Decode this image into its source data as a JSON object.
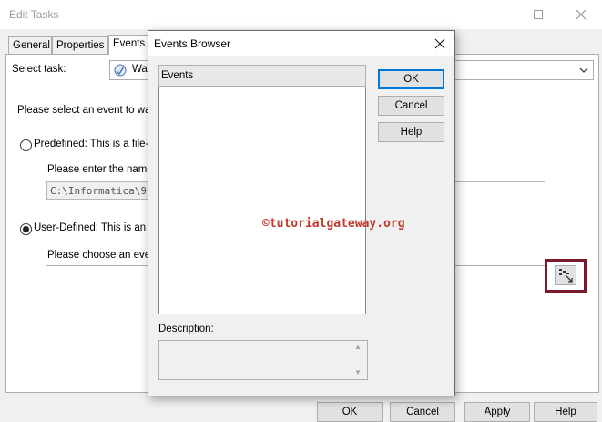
{
  "edit_window": {
    "title": "Edit Tasks",
    "tabs": [
      {
        "label": "General"
      },
      {
        "label": "Properties"
      },
      {
        "label": "Events"
      }
    ],
    "select_task_label": "Select task:",
    "task_combo_value": "Wai",
    "instruction": "Please select an event to wai",
    "predefined_label": "Predefined: This is a file-w",
    "name_label": "Please enter the name",
    "path_value": "C:\\Informatica\\9.6.1\\s",
    "userdefined_label": "User-Defined: This is an ev",
    "choose_label": "Please choose an even",
    "buttons": {
      "ok": "OK",
      "cancel": "Cancel",
      "apply": "Apply",
      "help": "Help"
    }
  },
  "events_dialog": {
    "title": "Events Browser",
    "events_header": "Events",
    "events": [],
    "description_label": "Description:",
    "description_value": "",
    "buttons": {
      "ok": "OK",
      "cancel": "Cancel",
      "help": "Help"
    }
  },
  "watermark": "©tutorialgateway.org",
  "colors": {
    "accent_focus": "#0078d7",
    "highlight_box": "#7a1a2a",
    "watermark": "#c0392b"
  }
}
